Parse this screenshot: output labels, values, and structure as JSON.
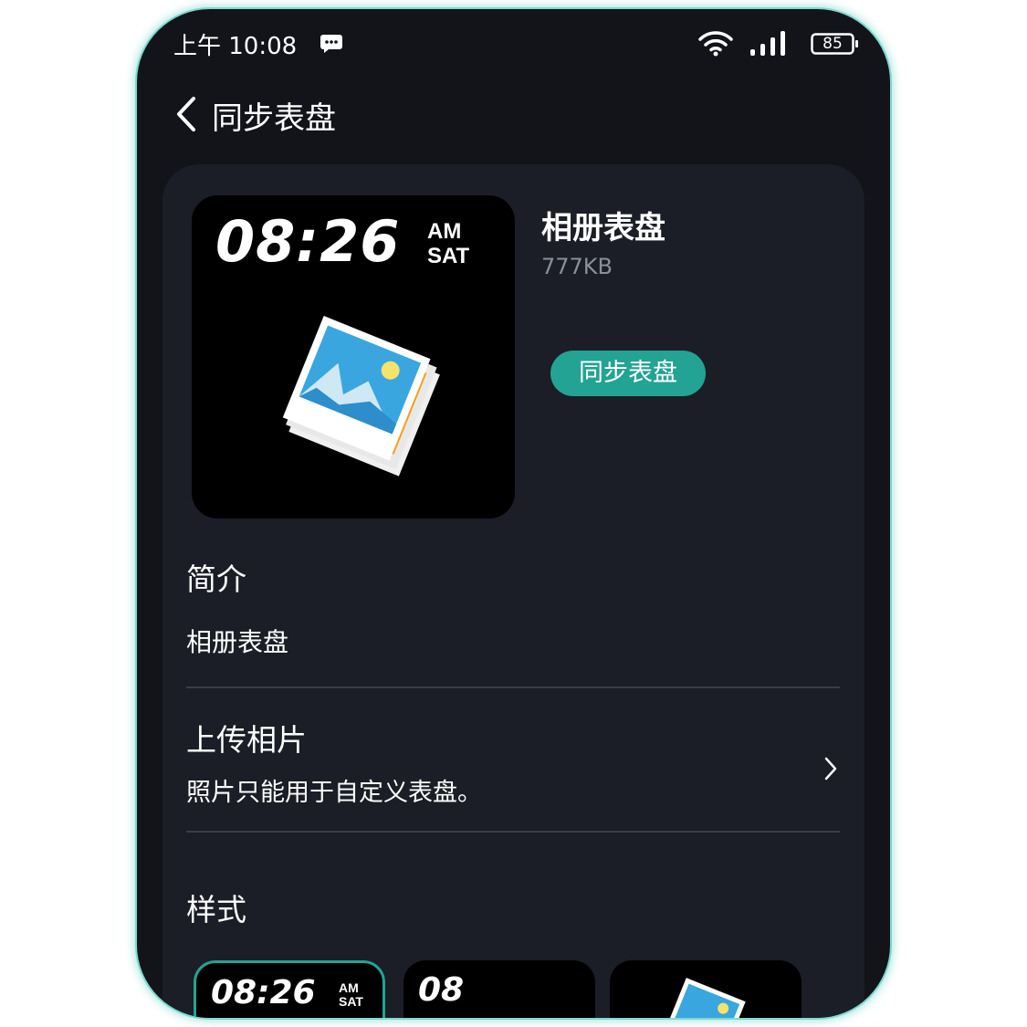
{
  "status_bar": {
    "time": "上午 10:08",
    "battery": "85"
  },
  "header": {
    "title": "同步表盘"
  },
  "watch_face": {
    "preview_time": "08:26",
    "preview_ampm": "AM",
    "preview_day": "SAT",
    "name": "相册表盘",
    "size": "777KB",
    "sync_button": "同步表盘"
  },
  "intro": {
    "title": "简介",
    "text": "相册表盘"
  },
  "upload": {
    "title": "上传相片",
    "description": "照片只能用于自定义表盘。"
  },
  "styles": {
    "title": "样式",
    "thumbs": [
      {
        "time": "08:26",
        "ampm": "AM",
        "day": "SAT"
      },
      {
        "time": "08"
      }
    ]
  },
  "colors": {
    "accent": "#23a394",
    "background": "#12141a",
    "card": "#1b1e26"
  }
}
